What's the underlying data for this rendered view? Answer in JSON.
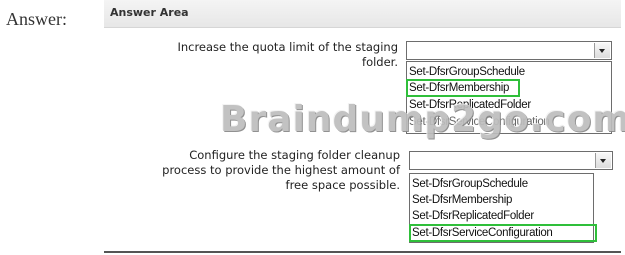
{
  "prefix_label": "Answer:",
  "panel": {
    "title": "Answer Area"
  },
  "questions": [
    {
      "prompt_lines": [
        "Increase the quota limit of the staging",
        "folder."
      ],
      "selected_value": "",
      "options": [
        {
          "label": "Set-DfsrGroupSchedule",
          "selected": false
        },
        {
          "label": "Set-DfsrMembership",
          "selected": true
        },
        {
          "label": "Set-DfsrReplicatedFolder",
          "selected": false
        },
        {
          "label": "Set-DfsrServiceConfiguration",
          "selected": false
        }
      ]
    },
    {
      "prompt_lines": [
        "Configure the staging folder cleanup",
        "process to provide the highest amount of",
        "free space possible."
      ],
      "selected_value": "",
      "options": [
        {
          "label": "Set-DfsrGroupSchedule",
          "selected": false
        },
        {
          "label": "Set-DfsrMembership",
          "selected": false
        },
        {
          "label": "Set-DfsrReplicatedFolder",
          "selected": false
        },
        {
          "label": "Set-DfsrServiceConfiguration",
          "selected": true
        }
      ]
    }
  ],
  "watermark": "Braindump2go.com",
  "colors": {
    "selection_outline": "#2fbf3a",
    "header_bg": "#ececec",
    "border": "#6d6d6d"
  },
  "icons": {
    "dropdown_arrow": "chevron-down-icon"
  }
}
